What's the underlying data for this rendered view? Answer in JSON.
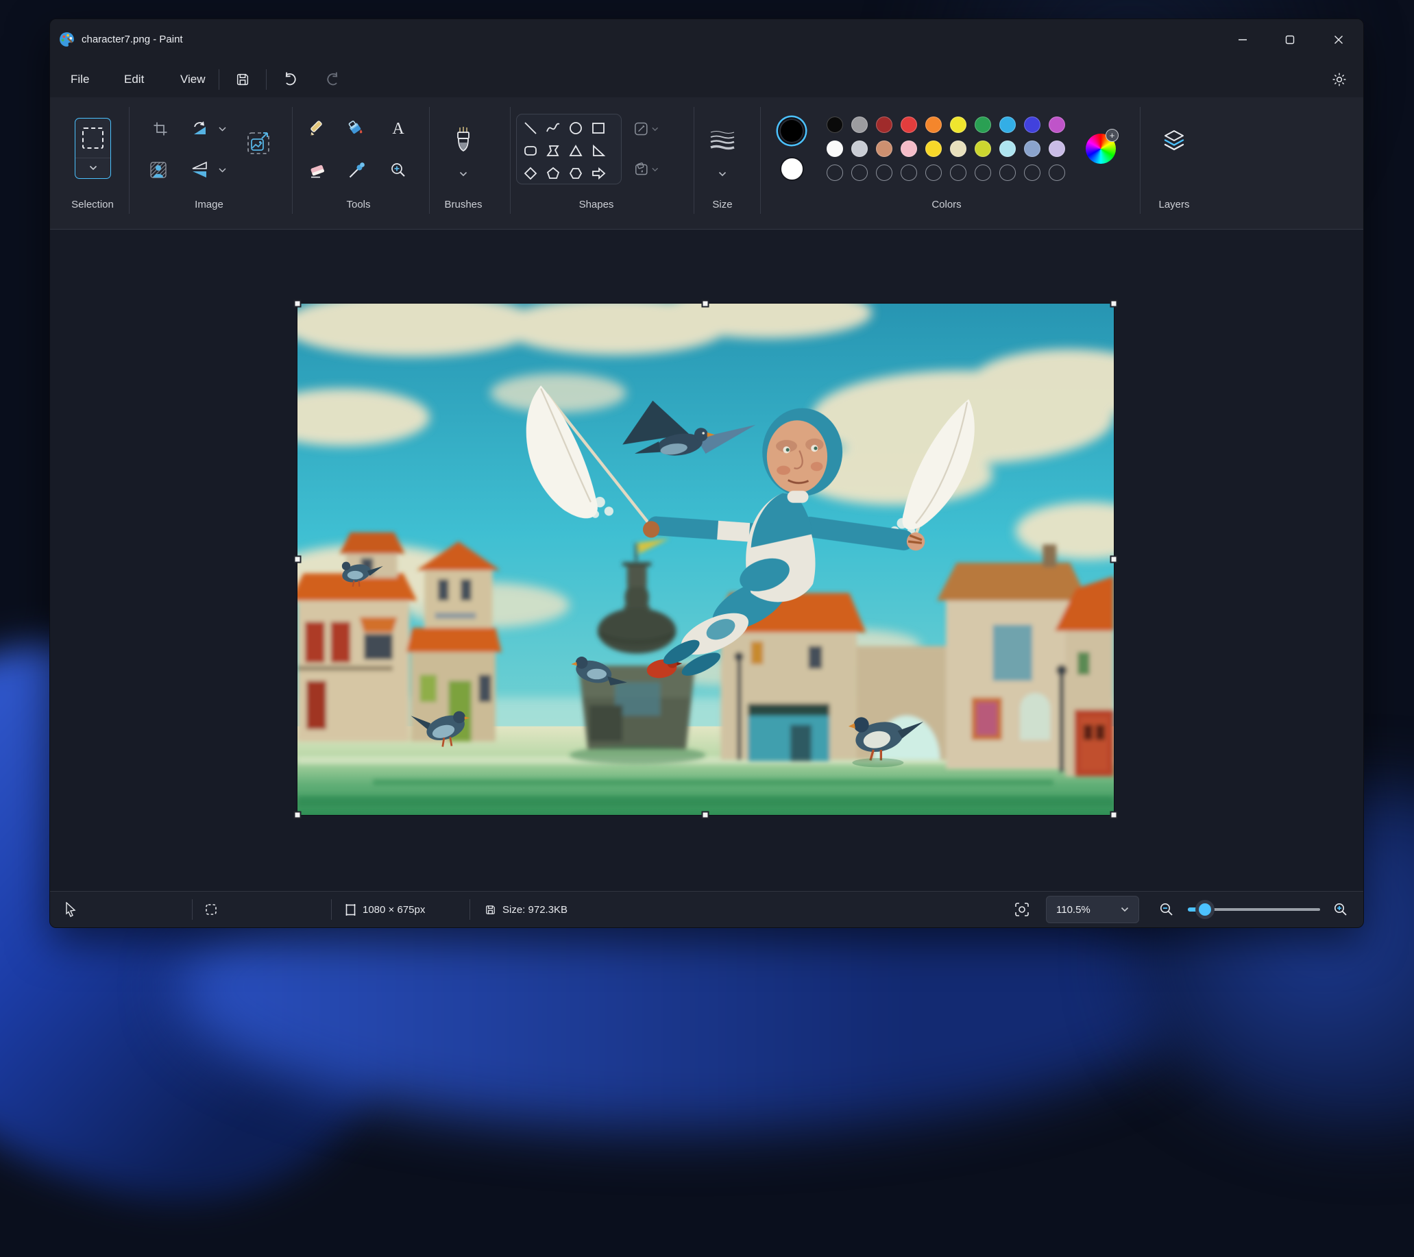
{
  "window": {
    "title": "character7.png - Paint"
  },
  "menu": {
    "items": [
      "File",
      "Edit",
      "View"
    ]
  },
  "ribbon": {
    "sections": {
      "selection": "Selection",
      "image": "Image",
      "tools": "Tools",
      "brushes": "Brushes",
      "shapes": "Shapes",
      "size": "Size",
      "colors": "Colors",
      "layers": "Layers"
    }
  },
  "shapes_list": [
    "line",
    "curve",
    "oval",
    "rectangle",
    "rounded-rectangle",
    "polygon",
    "triangle",
    "right-triangle",
    "diamond",
    "pentagon",
    "hexagon",
    "arrow"
  ],
  "colors": {
    "foreground": "#000000",
    "background": "#ffffff",
    "row1": [
      "#0a0a0a",
      "#9c9ca0",
      "#a02b2b",
      "#e23d3d",
      "#f4862c",
      "#efe52e",
      "#2aa053",
      "#33aee6",
      "#4141dd",
      "#bf54c9"
    ],
    "row2": [
      "#fafafa",
      "#c9ccd4",
      "#cd9070",
      "#f4bcc8",
      "#f7d729",
      "#e8e0bd",
      "#ccd62f",
      "#aee4f0",
      "#8aa3cc",
      "#c9bce6"
    ],
    "empty_slots": 10
  },
  "statusbar": {
    "canvas_size": "1080 × 675px",
    "file_size": "Size: 972.3KB",
    "zoom": "110.5%"
  },
  "accent": "#4cc2ff"
}
